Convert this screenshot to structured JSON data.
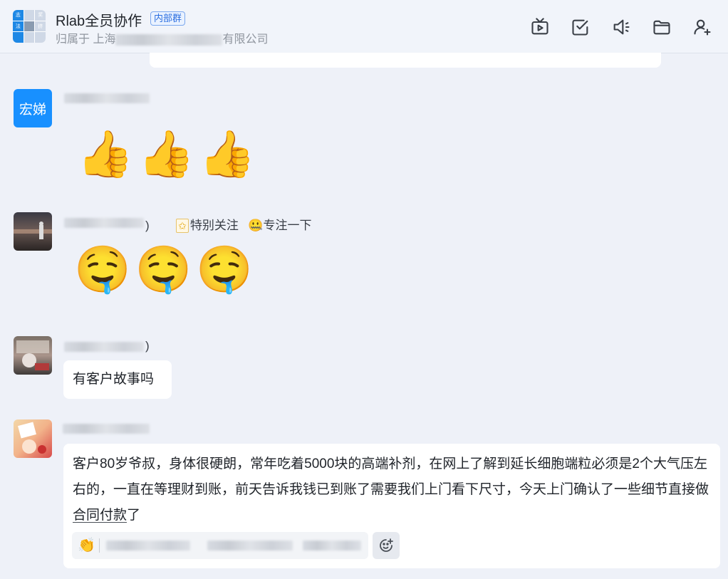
{
  "header": {
    "title": "Rlab全员协作",
    "tag": "内部群",
    "subtitle_prefix": "归属于 上海",
    "subtitle_suffix": "有限公司",
    "group_avatar_chars": [
      "志",
      "",
      "奖",
      "法",
      "",
      "挤",
      "",
      "",
      "",
      "",
      ""
    ]
  },
  "toolbar": {
    "icons": [
      "video-meeting-icon",
      "todo-icon",
      "announcement-icon",
      "folder-icon",
      "add-member-icon"
    ]
  },
  "messages": [
    {
      "avatar_text": "宏娣",
      "avatar_color": "#1890ff",
      "content": "👍👍👍"
    },
    {
      "badge_suffix": ")",
      "badge_special": "特别关注",
      "badge_status_emoji": "🤐",
      "badge_status": "专注一下",
      "content": "🤤🤤🤤"
    },
    {
      "name_suffix": ")",
      "text": "有客户故事吗"
    },
    {
      "text_part1": "客户80岁爷叔，身体很硬朗，常年吃着5000块的高端补剂，在网上了解到延长细胞端粒必须是2个大气压左右的，一直在等理财到账，前天告诉我钱已到账了需要我们上门看下尺寸，今天上门确认了一些细节直接做",
      "text_link1": "合同",
      "text_link2": "付款",
      "text_end": "了",
      "reaction_emoji": "👏"
    }
  ]
}
